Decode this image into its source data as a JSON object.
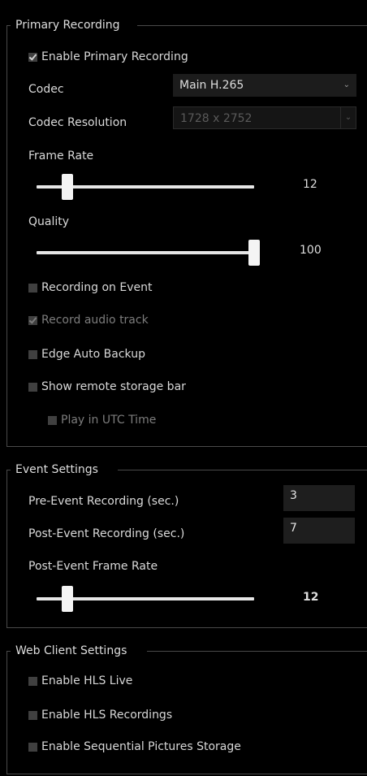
{
  "primary_recording": {
    "legend": "Primary Recording",
    "enable_primary": {
      "label": "Enable Primary Recording",
      "checked": true
    },
    "codec": {
      "label": "Codec",
      "value": "Main H.265",
      "chevron": "⌄"
    },
    "codec_resolution": {
      "label": "Codec Resolution",
      "value": "1728 x 2752",
      "chevron": "⌄"
    },
    "frame_rate": {
      "label": "Frame Rate",
      "value": "12",
      "fraction": 0.14
    },
    "quality": {
      "label": "Quality",
      "value": "100",
      "fraction": 1.0
    },
    "recording_on_event": {
      "label": "Recording on Event",
      "checked": false
    },
    "record_audio": {
      "label": "Record audio track",
      "checked": true
    },
    "edge_auto_backup": {
      "label": "Edge Auto Backup",
      "checked": false
    },
    "show_remote_storage": {
      "label": "Show remote storage bar",
      "checked": false
    },
    "play_utc": {
      "label": "Play in UTC Time",
      "checked": false
    }
  },
  "event_settings": {
    "legend": "Event Settings",
    "pre_event": {
      "label": "Pre-Event Recording (sec.)",
      "value": "3"
    },
    "post_event": {
      "label": "Post-Event Recording (sec.)",
      "value": "7"
    },
    "post_event_frame_rate": {
      "label": "Post-Event Frame Rate",
      "value": "12",
      "fraction": 0.14
    }
  },
  "web_client_settings": {
    "legend": "Web Client Settings",
    "hls_live": {
      "label": "Enable HLS Live",
      "checked": false
    },
    "hls_recordings": {
      "label": "Enable HLS Recordings",
      "checked": false
    },
    "sequential_pictures": {
      "label": "Enable Sequential Pictures Storage",
      "checked": false
    }
  }
}
